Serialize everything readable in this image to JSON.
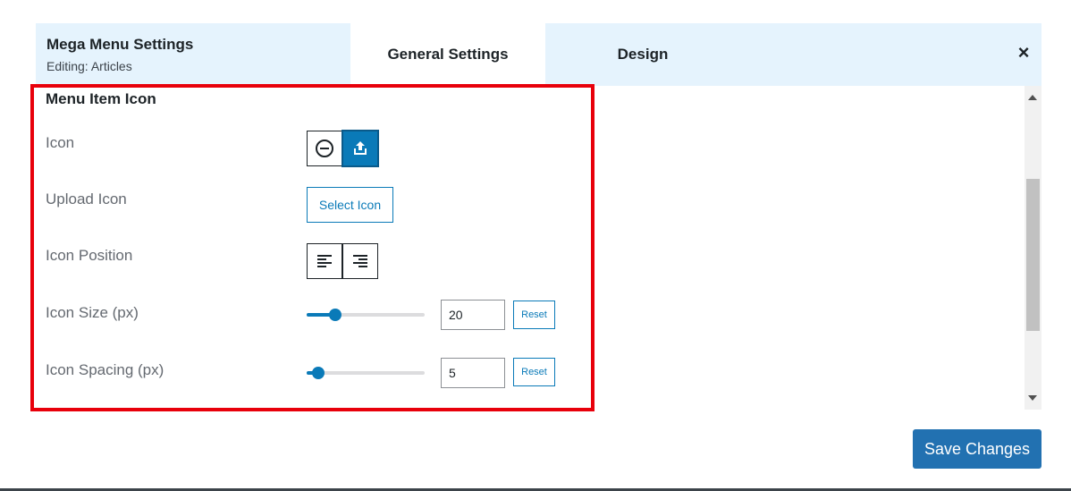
{
  "header": {
    "title": "Mega Menu Settings",
    "subtitle": "Editing: Articles",
    "tabs": [
      {
        "label": "General Settings",
        "active": true
      },
      {
        "label": "Design",
        "active": false
      }
    ],
    "close_label": "×"
  },
  "section": {
    "title": "Menu Item Icon",
    "rows": {
      "icon": {
        "label": "Icon",
        "options": [
          "none-icon",
          "upload-icon"
        ],
        "selected": "upload-icon"
      },
      "upload_icon": {
        "label": "Upload Icon",
        "button": "Select Icon"
      },
      "icon_position": {
        "label": "Icon Position",
        "options": [
          "align-left-icon",
          "align-right-icon"
        ]
      },
      "icon_size": {
        "label": "Icon Size (px)",
        "value": "20",
        "slider_fraction": 0.2,
        "reset": "Reset"
      },
      "icon_spacing": {
        "label": "Icon Spacing (px)",
        "value": "5",
        "slider_fraction": 0.05,
        "reset": "Reset"
      }
    }
  },
  "footer": {
    "save_label": "Save Changes"
  },
  "colors": {
    "accent": "#0a7ab8",
    "save": "#2271b1",
    "highlight": "#e8000b",
    "header_bg": "#e5f3fd"
  }
}
